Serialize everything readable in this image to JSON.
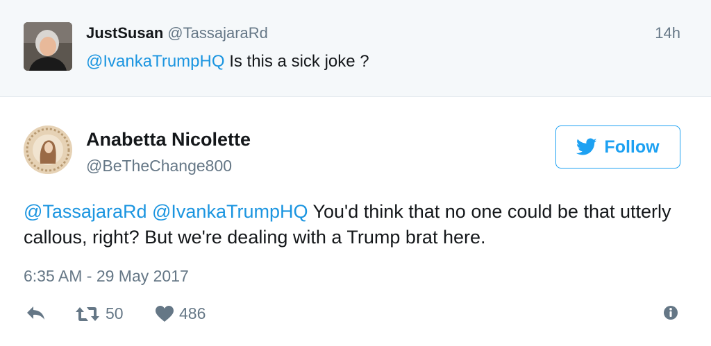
{
  "reply_context": {
    "name": "JustSusan",
    "handle": "@TassajaraRd",
    "time": "14h",
    "mention": "@IvankaTrumpHQ",
    "text": " Is this a sick joke ?"
  },
  "tweet": {
    "name": "Anabetta Nicolette",
    "handle": "@BeTheChange800",
    "follow_label": "Follow",
    "mention_1": "@TassajaraRd",
    "mention_2": "@IvankaTrumpHQ",
    "text": " You'd think that no one could be that utterly callous, right? But we're dealing with a Trump brat here.",
    "timestamp": "6:35 AM - 29 May 2017",
    "retweets": "50",
    "likes": "486"
  },
  "colors": {
    "accent": "#1da1f2",
    "mention": "#1b95e0",
    "muted": "#657786",
    "context_bg": "#f5f8fa"
  },
  "icons": [
    "reply-icon",
    "retweet-icon",
    "heart-icon",
    "info-icon",
    "twitter-bird-icon"
  ]
}
